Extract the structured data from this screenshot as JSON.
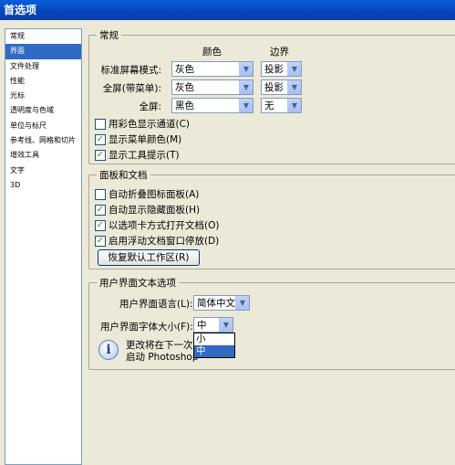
{
  "window": {
    "title": "首选项"
  },
  "sidebar": {
    "items": [
      {
        "label": "常规",
        "selected": false
      },
      {
        "label": "界面",
        "selected": true
      },
      {
        "label": "文件处理",
        "selected": false
      },
      {
        "label": "性能",
        "selected": false
      },
      {
        "label": "光标",
        "selected": false
      },
      {
        "label": "透明度与色域",
        "selected": false
      },
      {
        "label": "单位与标尺",
        "selected": false
      },
      {
        "label": "参考线、网格和切片",
        "selected": false
      },
      {
        "label": "增效工具",
        "selected": false
      },
      {
        "label": "文字",
        "selected": false
      },
      {
        "label": "3D",
        "selected": false
      }
    ]
  },
  "general": {
    "title": "常规",
    "color_header": "颜色",
    "border_header": "边界",
    "rows": [
      {
        "label": "标准屏幕模式:",
        "color": "灰色",
        "border": "投影"
      },
      {
        "label": "全屏(带菜单):",
        "color": "灰色",
        "border": "投影"
      },
      {
        "label": "全屏:",
        "color": "黑色",
        "border": "无"
      }
    ],
    "checks": [
      {
        "label": "用彩色显示通道(C)",
        "checked": false
      },
      {
        "label": "显示菜单颜色(M)",
        "checked": true
      },
      {
        "label": "显示工具提示(T)",
        "checked": true
      }
    ]
  },
  "panels": {
    "title": "面板和文档",
    "checks": [
      {
        "label": "自动折叠图标面板(A)",
        "checked": false
      },
      {
        "label": "自动显示隐藏面板(H)",
        "checked": true
      },
      {
        "label": "以选项卡方式打开文档(O)",
        "checked": true
      },
      {
        "label": "启用浮动文档窗口停放(D)",
        "checked": true
      }
    ],
    "reset_button": "恢复默认工作区(R)"
  },
  "ui_text": {
    "title": "用户界面文本选项",
    "language_label": "用户界面语言(L):",
    "language_value": "简体中文",
    "font_size_label": "用户界面字体大小(F):",
    "font_size_value": "中",
    "font_size_options": [
      {
        "label": "小",
        "selected": false
      },
      {
        "label": "中",
        "selected": true
      }
    ],
    "note_line1": "更改将在下一次",
    "note_line2": "启动 Photoshop"
  },
  "icons": {
    "dropdown_arrow": "chevron-down-icon",
    "info": "info-icon",
    "check": "checkmark-icon"
  }
}
